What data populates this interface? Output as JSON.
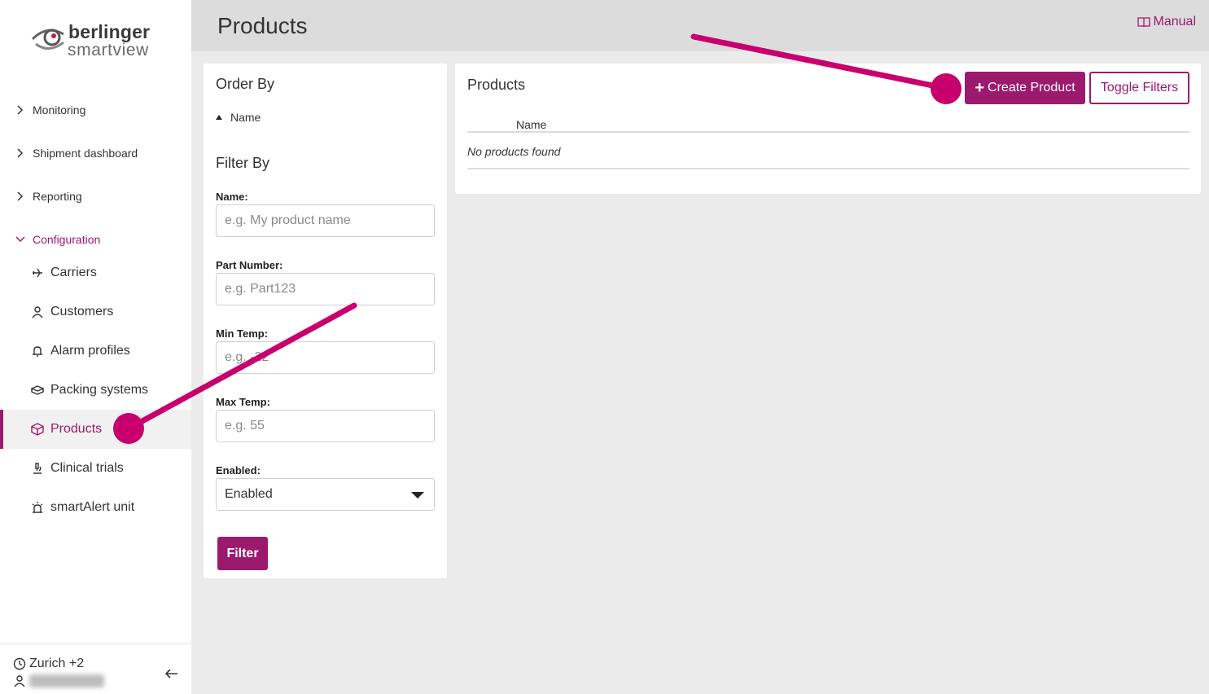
{
  "brand": {
    "line1": "berlinger",
    "line2": "smartview",
    "accent": "#9b1a6e"
  },
  "sidebar": {
    "sections": [
      {
        "label": "Monitoring",
        "expanded": false
      },
      {
        "label": "Shipment dashboard",
        "expanded": false
      },
      {
        "label": "Reporting",
        "expanded": false
      },
      {
        "label": "Configuration",
        "expanded": true
      }
    ],
    "items": [
      {
        "label": "Carriers",
        "icon": "plane-icon"
      },
      {
        "label": "Customers",
        "icon": "person-icon"
      },
      {
        "label": "Alarm profiles",
        "icon": "bell-icon"
      },
      {
        "label": "Packing systems",
        "icon": "packing-icon"
      },
      {
        "label": "Products",
        "icon": "box-icon",
        "active": true
      },
      {
        "label": "Clinical trials",
        "icon": "microscope-icon"
      },
      {
        "label": "smartAlert unit",
        "icon": "alert-light-icon"
      }
    ],
    "footer": {
      "timezone": "Zurich +2"
    }
  },
  "header": {
    "title": "Products",
    "manual_label": "Manual"
  },
  "filter_panel": {
    "order_by_title": "Order By",
    "order_by_field": "Name",
    "filter_by_title": "Filter By",
    "fields": [
      {
        "label": "Name:",
        "placeholder": "e.g. My product name"
      },
      {
        "label": "Part Number:",
        "placeholder": "e.g. Part123"
      },
      {
        "label": "Min Temp:",
        "placeholder": "e.g. -22"
      },
      {
        "label": "Max Temp:",
        "placeholder": "e.g. 55"
      }
    ],
    "enabled": {
      "label": "Enabled:",
      "value": "Enabled"
    },
    "filter_button": "Filter"
  },
  "products": {
    "title": "Products",
    "create_button": "Create Product",
    "toggle_button": "Toggle Filters",
    "columns": [
      "Name"
    ],
    "empty_text": "No products found"
  }
}
